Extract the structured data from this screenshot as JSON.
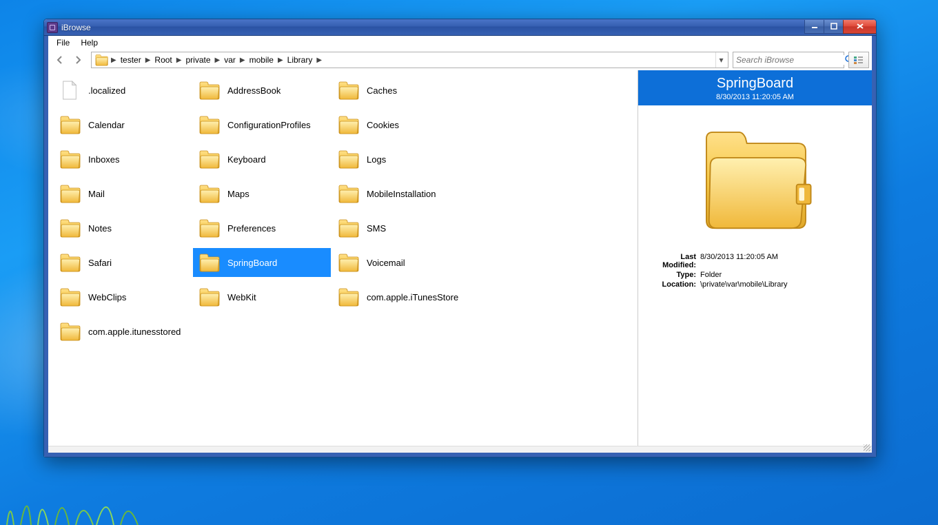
{
  "window": {
    "title": "iBrowse"
  },
  "menubar": {
    "items": [
      "File",
      "Help"
    ]
  },
  "breadcrumb": {
    "segments": [
      "tester",
      "Root",
      "private",
      "var",
      "mobile",
      "Library"
    ]
  },
  "search": {
    "placeholder": "Search iBrowse"
  },
  "columns": [
    [
      {
        "name": ".localized",
        "type": "file"
      },
      {
        "name": "Calendar",
        "type": "folder"
      },
      {
        "name": "Inboxes",
        "type": "folder"
      },
      {
        "name": "Mail",
        "type": "folder"
      },
      {
        "name": "Notes",
        "type": "folder"
      },
      {
        "name": "Safari",
        "type": "folder"
      },
      {
        "name": "WebClips",
        "type": "folder"
      },
      {
        "name": "com.apple.itunesstored",
        "type": "folder"
      }
    ],
    [
      {
        "name": "AddressBook",
        "type": "folder"
      },
      {
        "name": "ConfigurationProfiles",
        "type": "folder"
      },
      {
        "name": "Keyboard",
        "type": "folder"
      },
      {
        "name": "Maps",
        "type": "folder"
      },
      {
        "name": "Preferences",
        "type": "folder"
      },
      {
        "name": "SpringBoard",
        "type": "folder",
        "selected": true
      },
      {
        "name": "WebKit",
        "type": "folder"
      }
    ],
    [
      {
        "name": "Caches",
        "type": "folder"
      },
      {
        "name": "Cookies",
        "type": "folder"
      },
      {
        "name": "Logs",
        "type": "folder"
      },
      {
        "name": "MobileInstallation",
        "type": "folder"
      },
      {
        "name": "SMS",
        "type": "folder"
      },
      {
        "name": "Voicemail",
        "type": "folder"
      },
      {
        "name": "com.apple.iTunesStore",
        "type": "folder"
      }
    ]
  ],
  "details": {
    "title": "SpringBoard",
    "subtitle": "8/30/2013 11:20:05 AM",
    "props": {
      "modified_label": "Last Modified:",
      "modified": "8/30/2013 11:20:05 AM",
      "type_label": "Type:",
      "type": "Folder",
      "location_label": "Location:",
      "location": "\\private\\var\\mobile\\Library"
    }
  }
}
